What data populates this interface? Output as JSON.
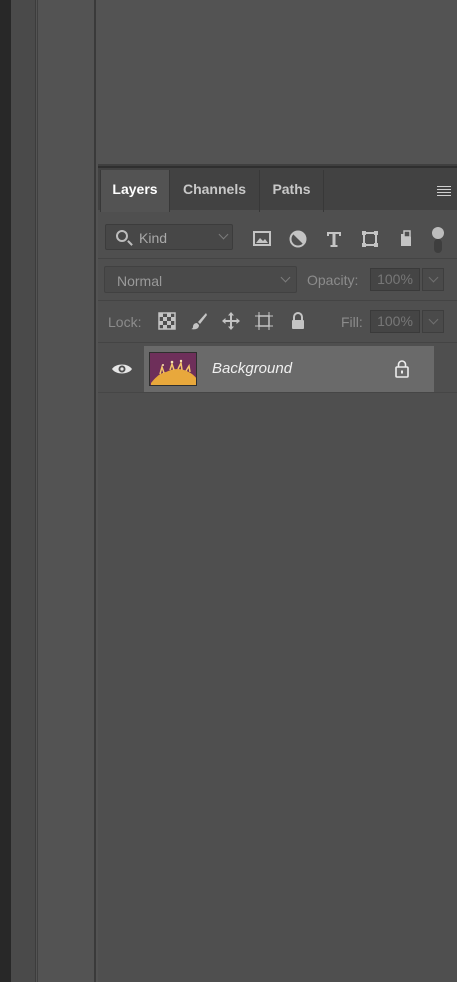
{
  "tabs": [
    {
      "label": "Layers",
      "active": true
    },
    {
      "label": "Channels",
      "active": false
    },
    {
      "label": "Paths",
      "active": false
    }
  ],
  "filter": {
    "kind_label": "Kind",
    "icons": [
      "image-filter-icon",
      "adjustment-filter-icon",
      "type-filter-icon",
      "shape-filter-icon",
      "smart-object-filter-icon"
    ]
  },
  "blend": {
    "mode": "Normal",
    "opacity_label": "Opacity:",
    "opacity_value": "100%"
  },
  "lock": {
    "label": "Lock:",
    "fill_label": "Fill:",
    "fill_value": "100%",
    "icons": [
      "lock-transparent-pixels-icon",
      "lock-image-pixels-icon",
      "lock-position-icon",
      "lock-artboard-icon",
      "lock-all-icon"
    ]
  },
  "layers": [
    {
      "name": "Background",
      "visible": true,
      "locked": true
    }
  ],
  "colors": {
    "panel_bg": "#4f4f4f",
    "tab_bar": "#424242",
    "selected_layer": "#6a6a6a",
    "thumb_bg": "#6e2f5a",
    "thumb_subject": "#e8a83c"
  }
}
